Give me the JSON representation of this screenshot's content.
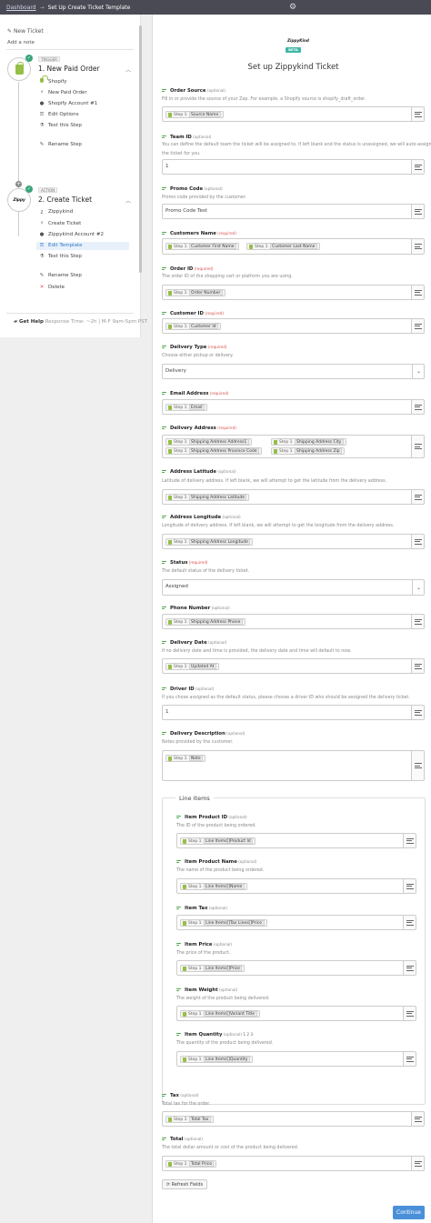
{
  "topbar": {
    "breadcrumb": "Dashboard",
    "arrow": "→",
    "title": "Set Up Create Ticket Template"
  },
  "sidebar": {
    "zap_name": "New Ticket",
    "add_note": "Add a note",
    "trigger": {
      "badge": "TRIGGER",
      "title": "1. New Paid Order",
      "items": [
        {
          "icon": "shopify-icon",
          "label": "Shopify"
        },
        {
          "icon": "bolt-icon",
          "label": "New Paid Order"
        },
        {
          "icon": "user-icon",
          "label": "Shopify Account #1"
        },
        {
          "icon": "list-icon",
          "label": "Edit Options"
        },
        {
          "icon": "flask-icon",
          "label": "Test this Step"
        },
        {
          "icon": "pencil-icon",
          "label": "Rename Step"
        }
      ]
    },
    "action": {
      "badge": "ACTION",
      "title": "2. Create Ticket",
      "items": [
        {
          "icon": "zippykind-icon",
          "label": "Zippykind"
        },
        {
          "icon": "bolt-icon",
          "label": "Create Ticket"
        },
        {
          "icon": "user-icon",
          "label": "Zippykind Account #2"
        },
        {
          "icon": "list-icon",
          "label": "Edit Template"
        },
        {
          "icon": "flask-icon",
          "label": "Test this Step"
        },
        {
          "icon": "pencil-icon",
          "label": "Rename Step"
        },
        {
          "icon": "delete-icon",
          "label": "Delete"
        }
      ]
    },
    "help": {
      "label": "Get Help",
      "hours": "Response Time: ~2h | M-F 9am-5pm PST"
    }
  },
  "main": {
    "logo_text": "ZippyKind",
    "beta": "BETA",
    "title": "Set up Zippykind Ticket",
    "step_label": "Step 1",
    "optional": "(optional)",
    "required": "(required)",
    "fields": [
      {
        "label": "Order Source",
        "flag": "optional",
        "desc": "Fill in or provide the source of your Zap. For example, a Shopify source is shopify_draft_order.",
        "pills": [
          "Source Name"
        ]
      },
      {
        "label": "Team ID",
        "flag": "optional",
        "desc": "You can define the default team the ticket will be assigned to. If left blank and the status is unassigned, we will auto-assign",
        "desc2": "the ticket for you.",
        "text": "1"
      },
      {
        "label": "Promo Code",
        "flag": "optional",
        "desc": "Promo code provided by the customer.",
        "text": "Promo Code Test",
        "nomap": false
      },
      {
        "label": "Customers Name",
        "flag": "required",
        "pills": [
          "Customer First Name",
          "Customer Last Name"
        ]
      },
      {
        "label": "Order ID",
        "flag": "required",
        "desc": "The order ID of the shopping cart or platform you are using.",
        "pills": [
          "Order Number"
        ]
      },
      {
        "label": "Customer ID",
        "flag": "required",
        "pills": [
          "Customer Id"
        ]
      },
      {
        "label": "Delivery Type",
        "flag": "required",
        "desc": "Choose either pickup or delivery.",
        "select": "Delivery"
      },
      {
        "label": "Email Address",
        "flag": "required",
        "pills": [
          "Email"
        ]
      },
      {
        "label": "Delivery Address",
        "flag": "required",
        "pills": [
          "Shipping Address Address1",
          "Shipping Address City",
          "Shipping Address Province Code",
          "Shipping Address Zip"
        ]
      },
      {
        "label": "Address Latitude",
        "flag": "optional",
        "desc": "Latitude of delivery address. If left blank, we will attempt to get the latitude from the delivery address.",
        "pills": [
          "Shipping Address Latitude"
        ]
      },
      {
        "label": "Address Longitude",
        "flag": "optional",
        "desc": "Longitude of delivery address. If left blank, we will attempt to get the longitude from the delivery address.",
        "pills": [
          "Shipping Address Longitude"
        ]
      },
      {
        "label": "Status",
        "flag": "required",
        "desc": "The default status of the delivery ticket.",
        "select": "Assigned"
      },
      {
        "label": "Phone Number",
        "flag": "optional",
        "pills": [
          "Shipping Address Phone"
        ]
      },
      {
        "label": "Delivery Date",
        "flag": "optional",
        "desc": "If no delivery date and time is provided, the delivery date and time will default to now.",
        "pills": [
          "Updated At"
        ]
      },
      {
        "label": "Driver ID",
        "flag": "optional",
        "desc": "If you chose assigned as the default status, please choose a driver ID who should be assigned the delivery ticket.",
        "text": "1"
      },
      {
        "label": "Delivery Description",
        "flag": "optional",
        "desc": "Notes provided by the customer.",
        "pills": [
          "Note"
        ]
      }
    ],
    "line_items": {
      "title": "Line Items",
      "fields": [
        {
          "label": "Item Product ID",
          "desc": "The ID of the product being ordered.",
          "pill": "Line Items[]Product Id"
        },
        {
          "label": "Item Product Name",
          "desc": "The name of the product being ordered.",
          "pill": "Line Items[]Name"
        },
        {
          "label": "Item Tax",
          "desc": "",
          "pill": "Line Items[]Tax Lines[]Price"
        },
        {
          "label": "Item Price",
          "desc": "The price of the product.",
          "pill": "Line Items[]Price"
        },
        {
          "label": "Item Weight",
          "desc": "The weight of the product being delivered.",
          "pill": "Line Items[]Variant Title"
        },
        {
          "label": "Item Quantity",
          "desc": "The quantity of the product being delivered.",
          "pill": "Line Items[]Quantity",
          "extra": "1 2 3"
        }
      ]
    },
    "tail_fields": [
      {
        "label": "Tax",
        "desc": "Total tax for the order.",
        "pill": "Total Tax"
      },
      {
        "label": "Total",
        "desc": "The total dollar amount or cost of the product being delivered.",
        "pill": "Total Price"
      }
    ],
    "refresh_label": "Refresh Fields",
    "continue_label": "Continue"
  }
}
